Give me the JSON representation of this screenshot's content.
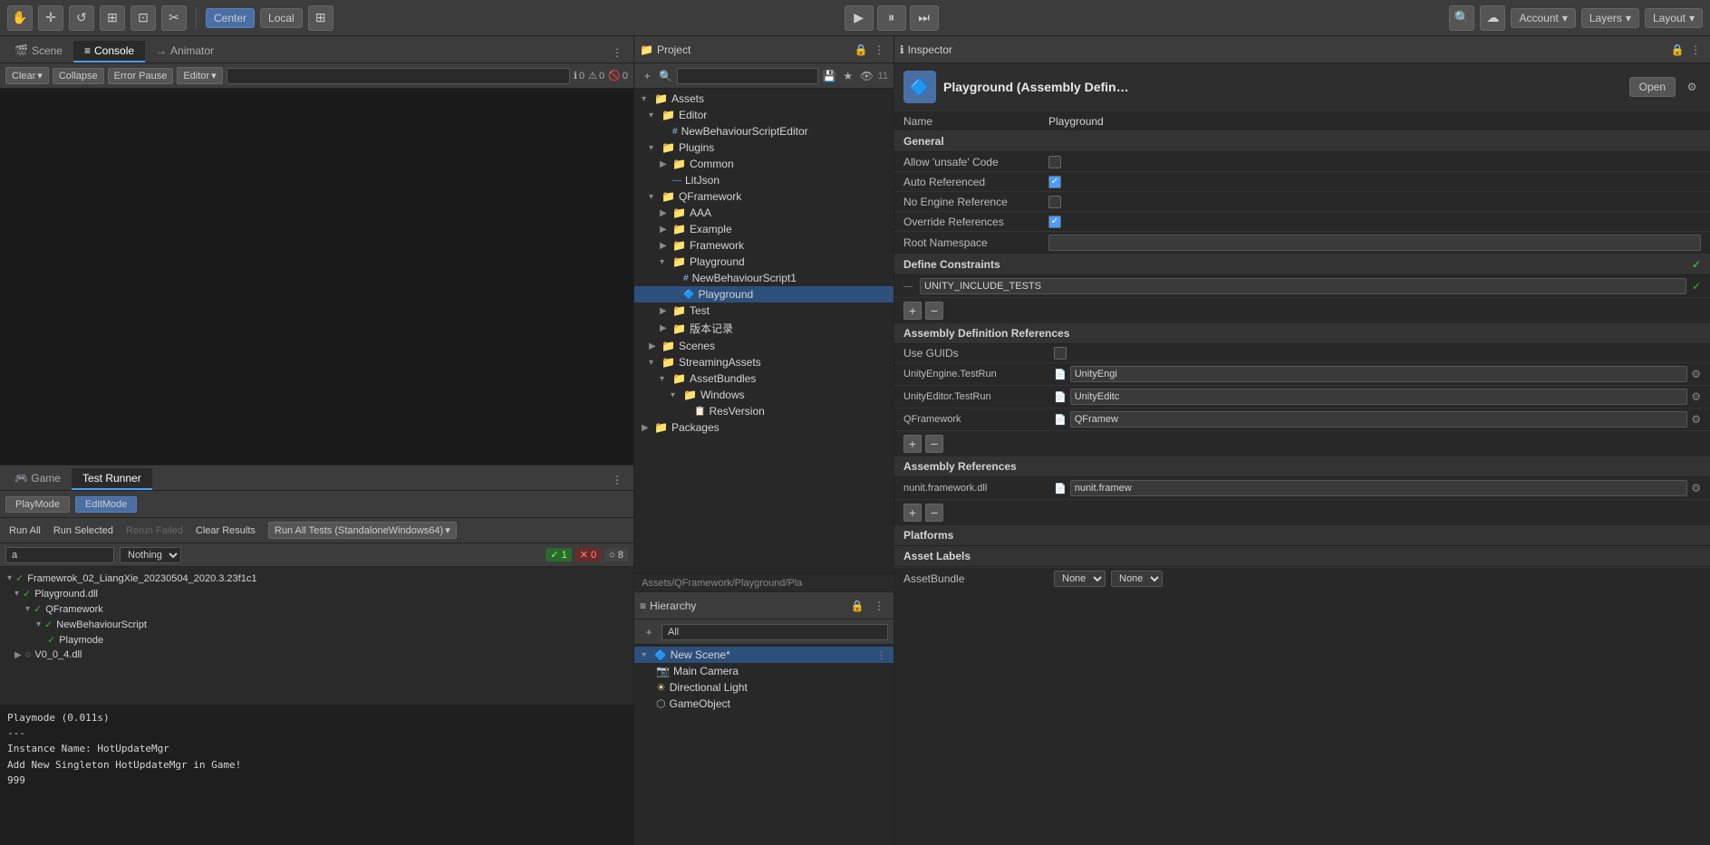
{
  "topToolbar": {
    "tools": [
      {
        "id": "hand",
        "label": "✋",
        "icon": "hand-icon"
      },
      {
        "id": "move",
        "label": "✛",
        "icon": "move-icon"
      },
      {
        "id": "rotate",
        "label": "↺",
        "icon": "rotate-icon"
      },
      {
        "id": "scale",
        "label": "⊞",
        "icon": "scale-icon"
      },
      {
        "id": "transform",
        "label": "⊡",
        "icon": "transform-icon"
      },
      {
        "id": "extra",
        "label": "✂",
        "icon": "extra-icon"
      }
    ],
    "centerLabel": "Center",
    "localLabel": "Local",
    "playLabel": "▶",
    "pauseLabel": "⏸",
    "stepLabel": "⏭",
    "cloudIcon": "☁",
    "searchIcon": "🔍",
    "accountLabel": "Account",
    "layersLabel": "Layers",
    "layoutLabel": "Layout"
  },
  "consoleTabs": {
    "tabs": [
      {
        "id": "scene",
        "label": "Scene",
        "icon": "🎬",
        "active": false
      },
      {
        "id": "console",
        "label": "Console",
        "icon": "≡",
        "active": true
      },
      {
        "id": "animator",
        "label": "Animator",
        "icon": "→",
        "active": false
      }
    ],
    "toolbar": {
      "clearLabel": "Clear",
      "collapseLabel": "Collapse",
      "errorPauseLabel": "Error Pause",
      "editorLabel": "Editor",
      "searchPlaceholder": "",
      "badge0Count": "0",
      "badge1Count": "0",
      "badge2Count": "0"
    }
  },
  "gameTestTabs": {
    "tabs": [
      {
        "id": "game",
        "label": "Game",
        "active": false
      },
      {
        "id": "testrunner",
        "label": "Test Runner",
        "active": true
      }
    ],
    "playModeBtn": "PlayMode",
    "editModeBtn": "EditMode",
    "runAllBtn": "Run All",
    "runSelectedBtn": "Run Selected",
    "rerunFailedBtn": "Rerun Failed",
    "clearResultsBtn": "Clear Results",
    "runAllTestsBtn": "Run All Tests (StandaloneWindows64)",
    "filterPlaceholder": "a",
    "filterDropdown": "Nothing",
    "badgeGreen": "1",
    "badgeRed": "0",
    "badgeGray": "8",
    "testItems": [
      {
        "level": 0,
        "check": true,
        "label": "Framewrok_02_LiangXie_20230504_2020.3.23f1c1",
        "indent": 0
      },
      {
        "level": 1,
        "check": true,
        "label": "Playground.dll",
        "indent": 1
      },
      {
        "level": 2,
        "check": true,
        "label": "QFramework",
        "indent": 2
      },
      {
        "level": 3,
        "check": true,
        "label": "NewBehaviourScript",
        "indent": 3
      },
      {
        "level": 4,
        "check": true,
        "label": "Playmode",
        "indent": 4
      },
      {
        "level": 1,
        "check": false,
        "circle": true,
        "label": "V0_0_4.dll",
        "indent": 1
      }
    ],
    "consoleLogs": [
      "Playmode (0.011s)",
      "---",
      "Instance Name: HotUpdateMgr",
      "Add New Singleton HotUpdateMgr in Game!",
      "999"
    ]
  },
  "project": {
    "title": "Project",
    "searchPlaceholder": "",
    "fileCount": "11",
    "tree": [
      {
        "type": "folder",
        "label": "Assets",
        "indent": 0,
        "expanded": true
      },
      {
        "type": "folder",
        "label": "Editor",
        "indent": 1,
        "expanded": true
      },
      {
        "type": "file-cs",
        "label": "NewBehaviourScriptEditor",
        "indent": 2
      },
      {
        "type": "folder",
        "label": "Plugins",
        "indent": 1,
        "expanded": true
      },
      {
        "type": "folder",
        "label": "Common",
        "indent": 2,
        "expanded": false
      },
      {
        "type": "file",
        "label": "LitJson",
        "indent": 2
      },
      {
        "type": "folder",
        "label": "QFramework",
        "indent": 1,
        "expanded": true
      },
      {
        "type": "folder",
        "label": "AAA",
        "indent": 2,
        "expanded": false
      },
      {
        "type": "folder",
        "label": "Example",
        "indent": 2,
        "expanded": false
      },
      {
        "type": "folder",
        "label": "Framework",
        "indent": 2,
        "expanded": false
      },
      {
        "type": "folder",
        "label": "Playground",
        "indent": 2,
        "expanded": true
      },
      {
        "type": "file-cs",
        "label": "NewBehaviourScript1",
        "indent": 3
      },
      {
        "type": "file-asmdef",
        "label": "Playground",
        "indent": 3,
        "selected": true
      },
      {
        "type": "folder",
        "label": "Test",
        "indent": 2,
        "expanded": false
      },
      {
        "type": "folder",
        "label": "版本记录",
        "indent": 2,
        "expanded": false
      },
      {
        "type": "folder",
        "label": "Scenes",
        "indent": 1,
        "expanded": false
      },
      {
        "type": "folder",
        "label": "StreamingAssets",
        "indent": 1,
        "expanded": true
      },
      {
        "type": "folder",
        "label": "AssetBundles",
        "indent": 2,
        "expanded": true
      },
      {
        "type": "folder",
        "label": "Windows",
        "indent": 3,
        "expanded": true
      },
      {
        "type": "file",
        "label": "ResVersion",
        "indent": 4
      },
      {
        "type": "folder",
        "label": "Packages",
        "indent": 0,
        "expanded": false
      }
    ],
    "statusBarPath": "Assets/QFramework/Playground/Pla"
  },
  "hierarchy": {
    "title": "Hierarchy",
    "searchPlaceholder": "All",
    "items": [
      {
        "label": "New Scene*",
        "type": "scene",
        "indent": 0,
        "expanded": true,
        "hasMenu": true
      },
      {
        "label": "Main Camera",
        "type": "camera",
        "indent": 1
      },
      {
        "label": "Directional Light",
        "type": "light",
        "indent": 1
      },
      {
        "label": "GameObject",
        "type": "gameobject",
        "indent": 1
      }
    ]
  },
  "inspector": {
    "title": "Inspector",
    "fileName": "Playground (Assembly Defin…",
    "openBtn": "Open",
    "nameLabel": "Name",
    "nameValue": "Playground",
    "generalHeader": "General",
    "fields": {
      "allowUnsafeCode": {
        "label": "Allow 'unsafe' Code",
        "checked": false
      },
      "autoReferenced": {
        "label": "Auto Referenced",
        "checked": true
      },
      "noEngineReference": {
        "label": "No Engine Reference",
        "checked": false
      },
      "overrideReferences": {
        "label": "Override References",
        "checked": true
      },
      "rootNamespace": {
        "label": "Root Namespace",
        "value": ""
      }
    },
    "defineConstraintsHeader": "Define Constraints",
    "defineConstraintCheck": true,
    "constraintItem": "UNITY_INCLUDE_TESTS",
    "assemblyDefRefsHeader": "Assembly Definition References",
    "useGUIDsLabel": "Use GUIDs",
    "useGUIDsChecked": false,
    "asmdefRefs": [
      {
        "label": "UnityEngine.TestRun",
        "value": "UnityEngi",
        "icon": "📄"
      },
      {
        "label": "UnityEditor.TestRun",
        "value": "UnityEditc",
        "icon": "📄"
      },
      {
        "label": "QFramework",
        "value": "QFramew",
        "icon": "📄"
      }
    ],
    "assemblyRefsHeader": "Assembly References",
    "assemblyRefs": [
      {
        "label": "nunit.framework.dll",
        "value": "nunit.framew",
        "icon": "📄"
      }
    ],
    "platformsHeader": "Platforms",
    "assetLabelsHeader": "Asset Labels",
    "assetBundleLabel": "AssetBundle",
    "assetBundleValue": "None",
    "assetBundleValue2": "None"
  }
}
